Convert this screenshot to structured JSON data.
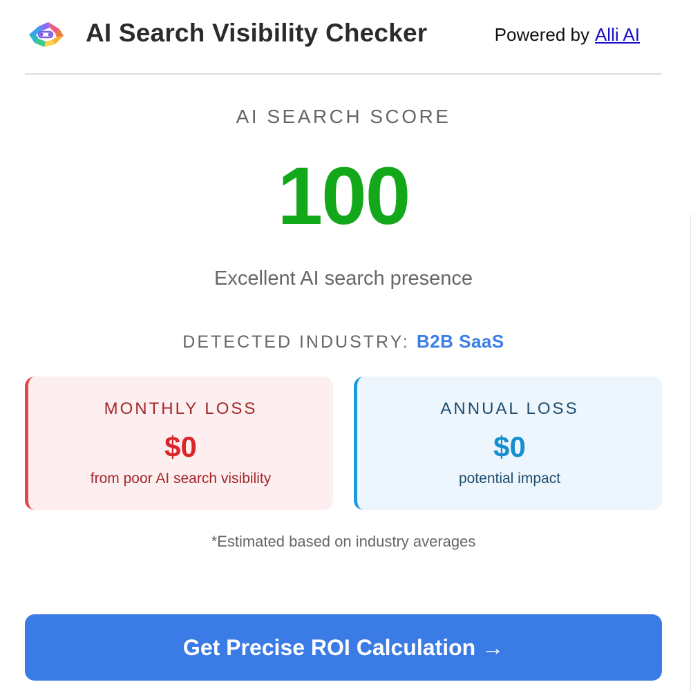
{
  "header": {
    "title": "AI Search Visibility Checker",
    "powered_prefix": "Powered by",
    "powered_link": "Alli AI",
    "logo_icon": "alli-ai-logo-icon"
  },
  "score": {
    "label": "AI SEARCH SCORE",
    "value": "100",
    "description": "Excellent AI search presence",
    "color": "#13a81a"
  },
  "industry": {
    "label": "DETECTED INDUSTRY:",
    "value": "B2B SaaS",
    "color": "#3c7fe8"
  },
  "cards": {
    "monthly": {
      "title": "MONTHLY LOSS",
      "value": "$0",
      "subtitle": "from poor AI search visibility",
      "accent": "#e14848"
    },
    "annual": {
      "title": "ANNUAL LOSS",
      "value": "$0",
      "subtitle": "potential impact",
      "accent": "#1d9ad8"
    }
  },
  "note": "*Estimated based on industry averages",
  "cta": {
    "label": "Get Precise ROI Calculation →",
    "color": "#3b7be6"
  }
}
